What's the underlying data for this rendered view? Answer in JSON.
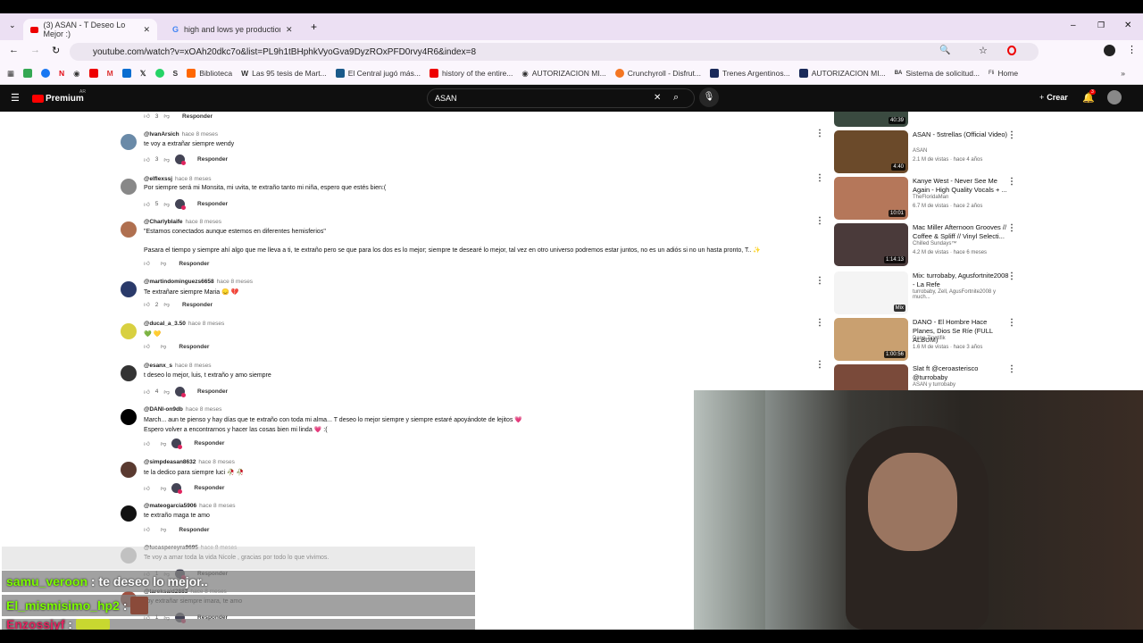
{
  "browser": {
    "tabs": [
      {
        "label": "(3) ASAN - T Deseo Lo Mejor :)",
        "icon": "youtube-icon"
      },
      {
        "label": "high and lows ye production cr",
        "icon": "google-icon"
      }
    ],
    "url": "youtube.com/watch?v=xOAh20dkc7o&list=PL9h1tBHphkVyoGva9DyzROxPFD0rvy4R6&index=8",
    "bookmarks": [
      "Biblioteca",
      "Las 95 tesis de Mart...",
      "El Central jugó más...",
      "history of the entire...",
      "AUTORIZACION MI...",
      "Crunchyroll - Disfrut...",
      "Trenes Argentinos...",
      "AUTORIZACION MI...",
      "Sistema de solicitud...",
      "Home"
    ]
  },
  "youtube": {
    "logo": "Premium",
    "region": "AR",
    "search_value": "ASAN",
    "create_label": "Crear",
    "notif_count": "3"
  },
  "comments": [
    {
      "user": "",
      "time": "",
      "text": "",
      "text2": "",
      "likes": "3",
      "reply": "Responder",
      "creator": false
    },
    {
      "user": "@IvanArsich",
      "time": "hace 8 meses",
      "text": "te voy a extrañar siempre wendy",
      "text2": "",
      "likes": "3",
      "reply": "Responder",
      "creator": true
    },
    {
      "user": "@elflexssj",
      "time": "hace 8 meses",
      "text": "Por siempre será mi Monsita, mi uvita, te extraño tanto mi niña, espero que estés bien:(",
      "text2": "",
      "likes": "5",
      "reply": "Responder",
      "creator": true
    },
    {
      "user": "@Charlyblaife",
      "time": "hace 8 meses",
      "text": "\"Estamos conectados aunque estemos en diferentes hemisferios\"",
      "text2": "Pasara el tiempo y siempre ahí algo que me lleva a ti, te extraño pero se que para los dos es lo mejor; siempre te desearé lo mejor, tal vez en otro universo podremos estar juntos, no es un adiós si no un hasta pronto, T.. ✨",
      "likes": "",
      "reply": "Responder",
      "creator": false
    },
    {
      "user": "@martindominguezs6658",
      "time": "hace 8 meses",
      "text": "Te extrañare siempre Maria 😞 💔",
      "text2": "",
      "likes": "2",
      "reply": "Responder",
      "creator": false
    },
    {
      "user": "@ducal_a_3.50",
      "time": "hace 8 meses",
      "text": "💚 💛",
      "text2": "",
      "likes": "",
      "reply": "Responder",
      "creator": false
    },
    {
      "user": "@esanx_s",
      "time": "hace 8 meses",
      "text": "t deseo lo mejor, luis, t extraño y amo siempre",
      "text2": "",
      "likes": "4",
      "reply": "Responder",
      "creator": true
    },
    {
      "user": "@DANI-on9db",
      "time": "hace 8 meses",
      "text": "March... aun te pienso y hay días que te extraño con toda mi alma... T deseo lo mejor siempre y siempre estaré apoyándote de lejitos 💗",
      "text2": "Espero volver a encontrarnos y hacer las cosas bien mi linda 💗 :(",
      "likes": "",
      "reply": "Responder",
      "creator": true
    },
    {
      "user": "@simpdeasan8632",
      "time": "hace 8 meses",
      "text": "te la dedico para siempre luci 🥀 🥀",
      "text2": "",
      "likes": "",
      "reply": "Responder",
      "creator": true
    },
    {
      "user": "@mateogarcia5906",
      "time": "hace 8 meses",
      "text": "te extraño maga te amo",
      "text2": "",
      "likes": "",
      "reply": "Responder",
      "creator": false
    },
    {
      "user": "@lucaspereyra9695",
      "time": "hace 8 meses",
      "text": "Te voy a amar toda la vida Nicole , gracias por todo lo que vivimos.",
      "text2": "",
      "likes": "1",
      "reply": "Responder",
      "creator": true
    },
    {
      "user": "@tareksaid2883",
      "time": "hace 8 meses",
      "text": "voy extrañar siempre imara, te amo",
      "text2": "",
      "likes": "1",
      "reply": "Responder",
      "creator": true
    }
  ],
  "sidebar_videos": [
    {
      "title": "",
      "channel": "",
      "stats": "",
      "duration": "40:39",
      "color": "#3a4a40"
    },
    {
      "title": "ASAN - 5strellas (Official Video)",
      "channel": "ASAN",
      "stats": "2.1 M de vistas · hace 4 años",
      "duration": "4:40",
      "color": "#6b4a2a"
    },
    {
      "title": "Kanye West - Never See Me Again - High Quality Vocals + ...",
      "channel": "TheFloridaMan",
      "stats": "6.7 M de vistas · hace 2 años",
      "duration": "10:01",
      "color": "#b5775a"
    },
    {
      "title": "Mac Miller Afternoon Grooves // Coffee & Spliff // Vinyl Selecti...",
      "channel": "Chilled Sundays™",
      "stats": "4.2 M de vistas · hace 6 meses",
      "duration": "1:14:13",
      "color": "#4a3a3a"
    },
    {
      "title": "Mix: turrobaby, Agusfortnite2008 - La Refe",
      "channel": "turrobaby, Zell, AgusFortnite2008 y much...",
      "stats": "",
      "duration": "Mix",
      "color": "#f4f4f4"
    },
    {
      "title": "DANO - El Hombre Hace Planes, Dios Se Ríe (FULL ALBUM)",
      "channel": "Dano Ziontifik",
      "stats": "1.6 M de vistas · hace 3 años",
      "duration": "1:00:56",
      "color": "#c9a070"
    },
    {
      "title": "Slat ft @ceroasterisco @turrobaby",
      "channel": "ASAN y turrobaby",
      "stats": "",
      "duration": "",
      "color": "#7a4a3a"
    }
  ],
  "chat": [
    {
      "user": "samu_veroon",
      "message": "te deseo lo mejor..",
      "color": "#7cfc00"
    },
    {
      "user": "El_mismisimo_hp2",
      "message": "",
      "color": "#7cfc00"
    },
    {
      "user": "Enzossjyf",
      "message": "",
      "color": "#e0245e"
    }
  ]
}
